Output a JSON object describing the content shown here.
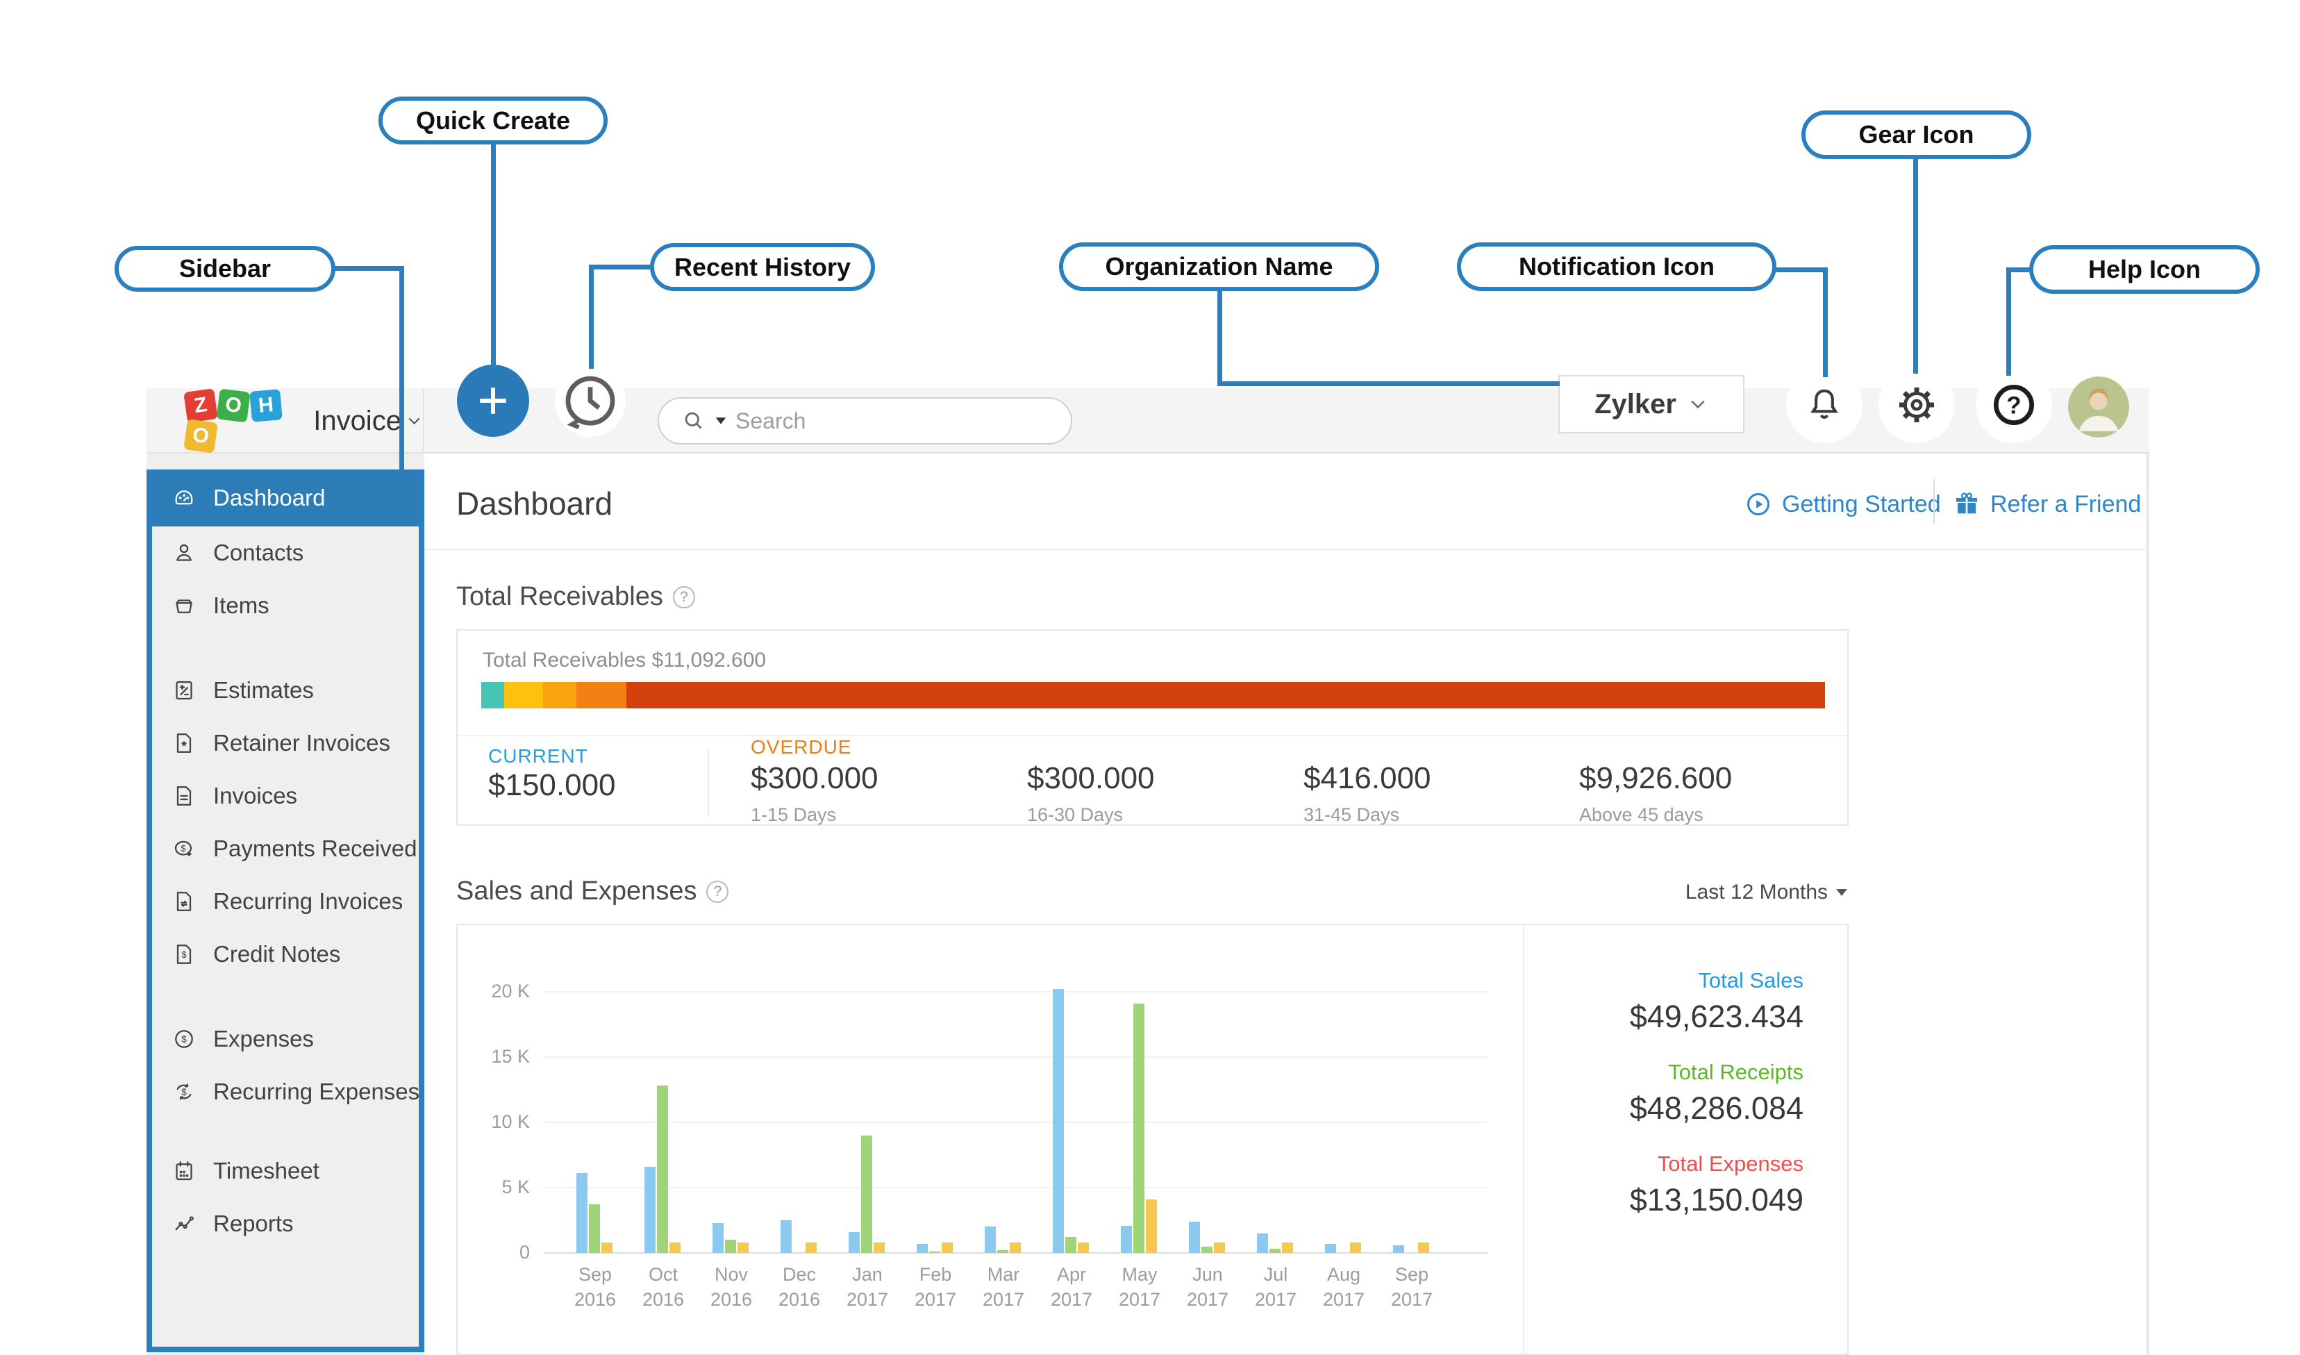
{
  "annotations": {
    "labels": {
      "quick_create": "Quick Create",
      "sidebar": "Sidebar",
      "recent_history": "Recent History",
      "organization_name": "Organization Name",
      "notification_icon": "Notification Icon",
      "gear_icon": "Gear Icon",
      "help_icon": "Help Icon"
    },
    "accent_color": "#2a7fc1"
  },
  "topbar": {
    "logo_tiles": [
      {
        "letter": "Z",
        "color": "#e23e33"
      },
      {
        "letter": "O",
        "color": "#3daf49"
      },
      {
        "letter": "H",
        "color": "#2aa1da"
      },
      {
        "letter": "O",
        "color": "#efb932"
      }
    ],
    "logo_product": "Invoice",
    "search_placeholder": "Search",
    "org_name": "Zylker"
  },
  "sidebar": {
    "items": [
      {
        "icon": "dashboard",
        "label": "Dashboard",
        "active": true
      },
      {
        "icon": "contacts",
        "label": "Contacts"
      },
      {
        "icon": "items",
        "label": "Items"
      },
      {
        "spacer": 46
      },
      {
        "icon": "estimates",
        "label": "Estimates"
      },
      {
        "icon": "retainer-invoices",
        "label": "Retainer Invoices"
      },
      {
        "icon": "invoices",
        "label": "Invoices"
      },
      {
        "icon": "payments-received",
        "label": "Payments Received"
      },
      {
        "icon": "recurring-invoices",
        "label": "Recurring Invoices"
      },
      {
        "icon": "credit-notes",
        "label": "Credit Notes"
      },
      {
        "spacer": 46
      },
      {
        "icon": "expenses",
        "label": "Expenses"
      },
      {
        "icon": "recurring-expenses",
        "label": "Recurring Expenses"
      },
      {
        "spacer": 38
      },
      {
        "icon": "timesheet",
        "label": "Timesheet"
      },
      {
        "icon": "reports",
        "label": "Reports"
      }
    ]
  },
  "header": {
    "title": "Dashboard",
    "getting_started": "Getting Started",
    "refer_a_friend": "Refer a Friend"
  },
  "receivables": {
    "section_title": "Total Receivables",
    "summary_label": "Total Receivables",
    "summary_value": "$11,092.600",
    "bar_segments": [
      {
        "color": "#46c4b5",
        "width_pct": 1.7
      },
      {
        "color": "#fec10d",
        "width_pct": 2.9
      },
      {
        "color": "#f7a40e",
        "width_pct": 2.5
      },
      {
        "color": "#f08112",
        "width_pct": 3.7
      },
      {
        "color": "#d2400e",
        "width_pct": 89.2
      }
    ],
    "current_label": "CURRENT",
    "current_value": "$150.000",
    "overdue_label": "OVERDUE",
    "aging": [
      {
        "value": "$300.000",
        "period": "1-15 Days"
      },
      {
        "value": "$300.000",
        "period": "16-30 Days"
      },
      {
        "value": "$416.000",
        "period": "31-45 Days"
      },
      {
        "value": "$9,926.600",
        "period": "Above 45 days"
      }
    ]
  },
  "sales_expenses": {
    "section_title": "Sales and Expenses",
    "range_label": "Last 12 Months",
    "totals": [
      {
        "label": "Total Sales",
        "value": "$49,623.434",
        "color": "#2b9be0"
      },
      {
        "label": "Total Receipts",
        "value": "$48,286.084",
        "color": "#5cb824"
      },
      {
        "label": "Total Expenses",
        "value": "$13,150.049",
        "color": "#ef4d4d"
      }
    ]
  },
  "chart_data": {
    "type": "bar",
    "title": "Sales and Expenses",
    "xlabel": "",
    "ylabel": "",
    "unit": "K",
    "ylim": [
      0,
      20
    ],
    "grid": true,
    "legend": "none",
    "categories": [
      "Sep 2016",
      "Oct 2016",
      "Nov 2016",
      "Dec 2016",
      "Jan 2017",
      "Feb 2017",
      "Mar 2017",
      "Apr 2017",
      "May 2017",
      "Jun 2017",
      "Jul 2017",
      "Aug 2017",
      "Sep 2017"
    ],
    "yticks": [
      {
        "v": 0,
        "label": "0"
      },
      {
        "v": 5,
        "label": "5 K"
      },
      {
        "v": 10,
        "label": "10 K"
      },
      {
        "v": 15,
        "label": "15 K"
      },
      {
        "v": 20,
        "label": "20 K"
      }
    ],
    "series": [
      {
        "name": "Sales",
        "color": "#8bc9ee",
        "values": [
          6.1,
          6.6,
          2.3,
          2.5,
          1.6,
          0.7,
          2.0,
          20.2,
          2.1,
          2.4,
          1.5,
          0.7,
          0.6
        ]
      },
      {
        "name": "Receipts",
        "color": "#a0d478",
        "values": [
          3.7,
          12.8,
          1.0,
          0,
          9.0,
          0.1,
          0.2,
          1.2,
          19.1,
          0.5,
          0.3,
          0,
          0
        ]
      },
      {
        "name": "Expenses",
        "color": "#f5c84f",
        "values": [
          0.8,
          0.8,
          0.8,
          0.8,
          0.8,
          0.8,
          0.8,
          0.8,
          4.1,
          0.8,
          0.8,
          0.8,
          0.8
        ]
      }
    ]
  }
}
